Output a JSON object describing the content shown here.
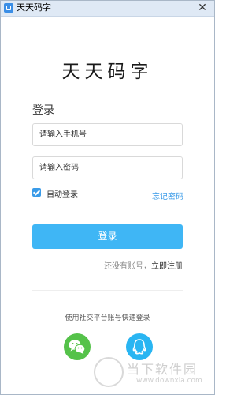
{
  "window": {
    "title": "天天码字",
    "close_glyph": "✕"
  },
  "brand": {
    "name": "天天码字"
  },
  "login": {
    "section_title": "登录",
    "phone_placeholder": "请输入手机号",
    "password_placeholder": "请输入密码",
    "auto_login_label": "自动登录",
    "auto_login_checked": true,
    "forgot_password": "忘记密码",
    "login_button": "登录",
    "register_prompt": "还没有账号，",
    "register_link": "立即注册"
  },
  "social": {
    "label": "使用社交平台账号快速登录",
    "providers": [
      {
        "name": "wechat",
        "icon": "wechat-icon",
        "color": "#55c24a"
      },
      {
        "name": "qq",
        "icon": "qq-icon",
        "color": "#29b5f2"
      }
    ]
  },
  "watermark": {
    "text": "当下软件园",
    "url": "www.downxia.com"
  },
  "colors": {
    "accent": "#3fb6f5",
    "link": "#3a9be8",
    "titlebar": "#dfe9f5"
  }
}
